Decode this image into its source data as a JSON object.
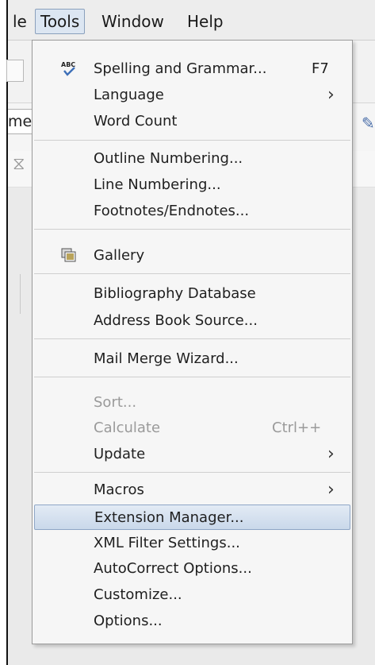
{
  "menubar": {
    "items": [
      {
        "label": "le"
      },
      {
        "label": "Tools"
      },
      {
        "label": "Window"
      },
      {
        "label": "Help"
      }
    ]
  },
  "background": {
    "style_box_text": "me"
  },
  "tools_menu": {
    "items": [
      {
        "label": "Spelling and Grammar...",
        "shortcut": "F7",
        "icon": "spellcheck-icon"
      },
      {
        "label": "Language",
        "submenu": true
      },
      {
        "label": "Word Count"
      },
      {
        "label": "Outline Numbering..."
      },
      {
        "label": "Line Numbering..."
      },
      {
        "label": "Footnotes/Endnotes..."
      },
      {
        "label": "Gallery",
        "icon": "gallery-icon"
      },
      {
        "label": "Bibliography Database"
      },
      {
        "label": "Address Book Source..."
      },
      {
        "label": "Mail Merge Wizard..."
      },
      {
        "label": "Sort...",
        "disabled": true
      },
      {
        "label": "Calculate",
        "shortcut": "Ctrl++",
        "disabled": true
      },
      {
        "label": "Update",
        "submenu": true
      },
      {
        "label": "Macros",
        "submenu": true
      },
      {
        "label": "Extension Manager...",
        "selected": true
      },
      {
        "label": "XML Filter Settings..."
      },
      {
        "label": "AutoCorrect Options..."
      },
      {
        "label": "Customize..."
      },
      {
        "label": "Options..."
      }
    ]
  },
  "colors": {
    "selection": "#c9d8ea",
    "menu_bg": "#f6f6f6",
    "disabled_text": "#9a9a9a"
  }
}
